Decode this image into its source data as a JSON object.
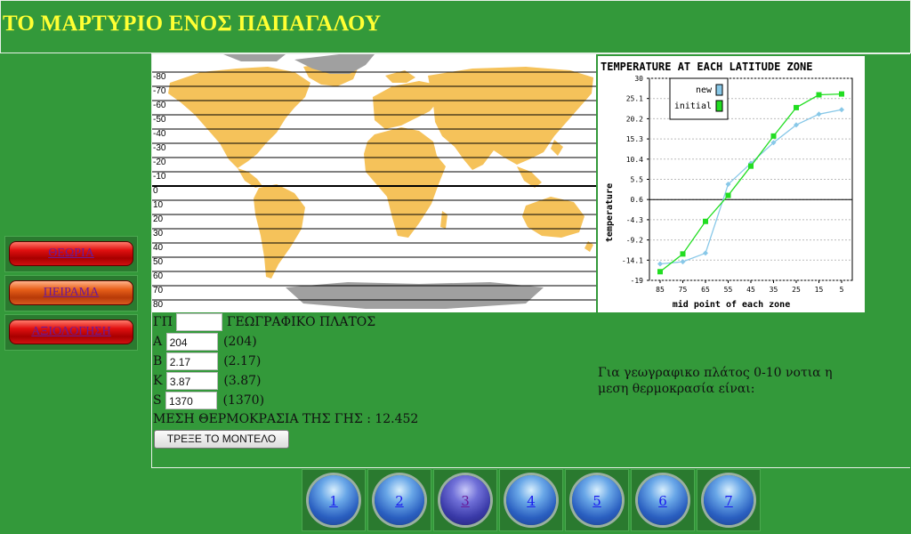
{
  "page_title": "ΤΟ ΜΑΡΤΥΡΙΟ ΕΝΟΣ ΠΑΠΑΓΑΛΟΥ",
  "sidebar": {
    "items": [
      {
        "label": "ΘΕΩΡΙΑ"
      },
      {
        "label": "ΠΕΙΡΑΜΑ"
      },
      {
        "label": "ΑΞΙΟΛΟΓΗΣΗ"
      }
    ]
  },
  "map": {
    "latitude_labels": [
      "80",
      "70",
      "60",
      "50",
      "40",
      "30",
      "20",
      "10",
      "0",
      "10",
      "20",
      "30",
      "40",
      "50",
      "60",
      "70",
      "80"
    ],
    "latitude_prefixes": [
      "-",
      "-",
      "-",
      "-",
      "-",
      "-",
      "-",
      "-",
      "",
      "",
      "",
      "",
      "",
      "",
      "",
      "",
      ""
    ]
  },
  "form": {
    "gp_label": "ΓΠ",
    "gp_value": "",
    "gp_caption": "ΓΕΩΓΡΑΦΙΚΟ ΠΛΑΤΟΣ",
    "a_label": "A",
    "a_value": "204",
    "a_default": "(204)",
    "b_label": "B",
    "b_value": "2.17",
    "b_default": "(2.17)",
    "k_label": "K",
    "k_value": "3.87",
    "k_default": "(3.87)",
    "s_label": "S",
    "s_value": "1370",
    "s_default": "(1370)",
    "mean_temp_text": "ΜΕΣΗ ΘΕΡΜΟΚΡΑΣΙΑ ΤΗΣ ΓΗΣ : 12.452",
    "run_button": "ΤΡΕΞΕ ΤΟ ΜΟΝΤΕΛΟ"
  },
  "note": "Για γεωγραφικο πλάτος 0-10 νοτια η μεση θερμοκρασία είναι:",
  "pager": {
    "pages": [
      "1",
      "2",
      "3",
      "4",
      "5",
      "6",
      "7"
    ],
    "active": "3"
  },
  "colors": {
    "background": "#33993a",
    "title": "#ffff33",
    "new_series": "#88c8e8",
    "initial_series": "#22dd22"
  },
  "chart_data": {
    "type": "line",
    "title": "TEMPERATURE AT EACH LATITUDE ZONE",
    "xlabel": "mid point of each zone",
    "ylabel": "temperature",
    "categories": [
      "85",
      "75",
      "65",
      "55",
      "45",
      "35",
      "25",
      "15",
      "5"
    ],
    "y_ticks": [
      "30",
      "25.1",
      "20.2",
      "15.3",
      "10.4",
      "5.5",
      "0.6",
      "-4.3",
      "-9.2",
      "-14.1",
      "-19"
    ],
    "ylim": [
      -19,
      30
    ],
    "legend_position": "top-left",
    "series": [
      {
        "name": "new",
        "color": "#88c8e8",
        "values": [
          -15.0,
          -14.5,
          -12.4,
          4.3,
          9.4,
          14.4,
          18.7,
          21.3,
          22.4
        ]
      },
      {
        "name": "initial",
        "color": "#22dd22",
        "values": [
          -16.9,
          -12.6,
          -4.7,
          1.6,
          8.7,
          16.0,
          22.9,
          26.0,
          26.2
        ]
      }
    ]
  }
}
